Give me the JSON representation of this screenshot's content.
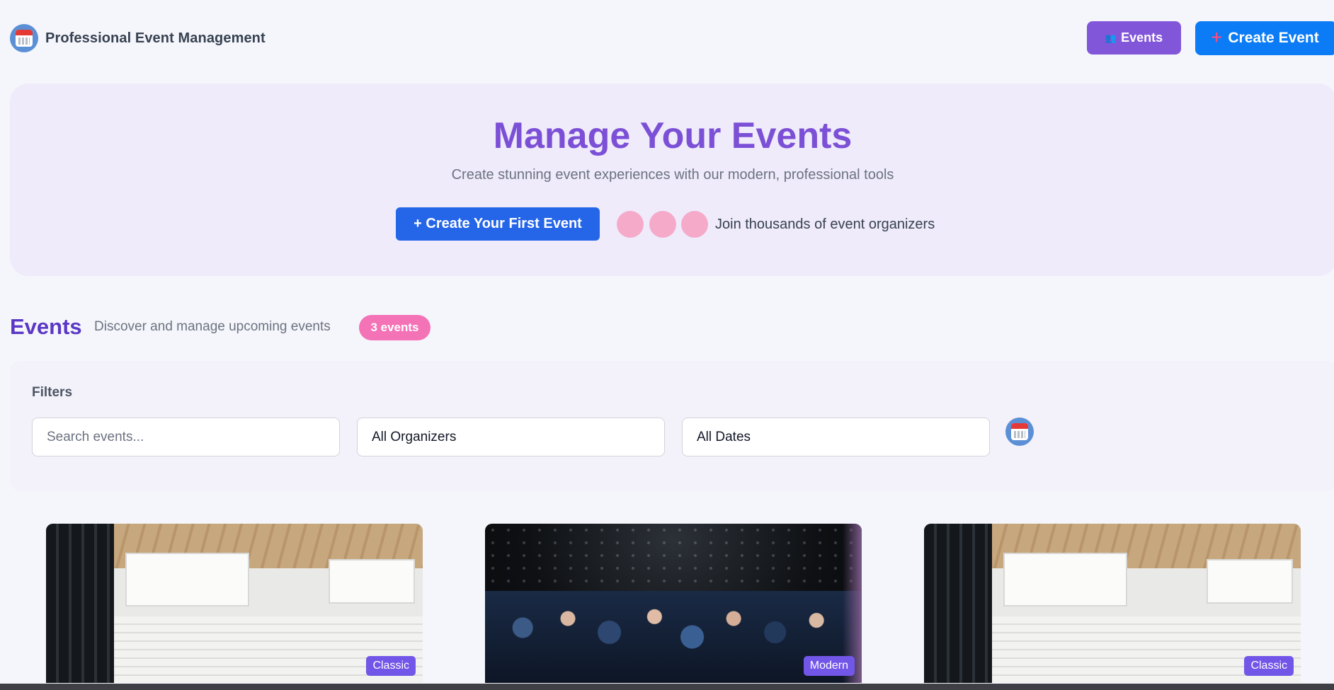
{
  "header": {
    "brand_title": "Professional Event Management",
    "events_button": "Events",
    "create_button": "Create Event"
  },
  "hero": {
    "title": "Manage Your Events",
    "subtitle": "Create stunning event experiences with our modern, professional tools",
    "cta": "+ Create Your First Event",
    "join_text": "Join thousands of event organizers"
  },
  "events": {
    "title": "Events",
    "subtitle": "Discover and manage upcoming events",
    "count_badge": "3 events"
  },
  "filters": {
    "label": "Filters",
    "search_placeholder": "Search events...",
    "organizer_value": "All Organizers",
    "date_value": "All Dates"
  },
  "cards": [
    {
      "tag": "Classic"
    },
    {
      "tag": "Modern"
    },
    {
      "tag": "Classic"
    }
  ],
  "colors": {
    "primary_purple": "#8256d9",
    "primary_blue": "#0b7cf5",
    "cta_blue": "#2565e8",
    "badge_pink": "#f472b6",
    "hero_bg": "#efebfb",
    "tag_purple": "#7256e8"
  },
  "icons": {
    "brand": "calendar-icon",
    "events_button": "people-icon",
    "create_button": "plus-icon",
    "filter_action": "calendar-icon"
  }
}
